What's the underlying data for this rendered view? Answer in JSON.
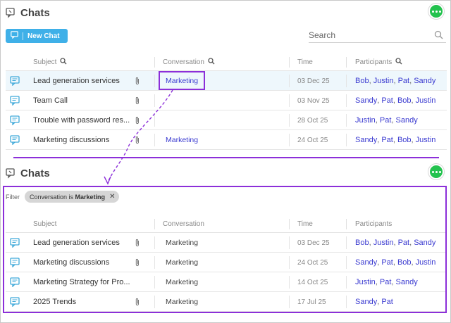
{
  "top": {
    "title": "Chats",
    "new_chat_label": "New Chat",
    "search_placeholder": "Search",
    "columns": {
      "subject": "Subject",
      "conversation": "Conversation",
      "time": "Time",
      "participants": "Participants"
    },
    "rows": [
      {
        "subject": "Lead generation services",
        "attachment": true,
        "conversation": "Marketing",
        "time": "03 Dec 25",
        "participants": [
          "Bob",
          "Justin",
          "Pat",
          "Sandy"
        ]
      },
      {
        "subject": "Team Call",
        "attachment": true,
        "conversation": "",
        "time": "03 Nov 25",
        "participants": [
          "Sandy",
          "Pat",
          "Bob",
          "Justin"
        ]
      },
      {
        "subject": "Trouble with password res...",
        "attachment": true,
        "conversation": "",
        "time": "28 Oct 25",
        "participants": [
          "Justin",
          "Pat",
          "Sandy"
        ]
      },
      {
        "subject": "Marketing discussions",
        "attachment": true,
        "conversation": "Marketing",
        "time": "24 Oct 25",
        "participants": [
          "Sandy",
          "Pat",
          "Bob",
          "Justin"
        ]
      }
    ]
  },
  "bottom": {
    "title": "Chats",
    "filter_label": "Filter",
    "filter_chip_prefix": "Conversation is",
    "filter_chip_value": "Marketing",
    "columns": {
      "subject": "Subject",
      "conversation": "Conversation",
      "time": "Time",
      "participants": "Participants"
    },
    "rows": [
      {
        "subject": "Lead generation services",
        "attachment": true,
        "conversation": "Marketing",
        "time": "03 Dec 25",
        "participants": [
          "Bob",
          "Justin",
          "Pat",
          "Sandy"
        ]
      },
      {
        "subject": "Marketing discussions",
        "attachment": true,
        "conversation": "Marketing",
        "time": "24 Oct 25",
        "participants": [
          "Sandy",
          "Pat",
          "Bob",
          "Justin"
        ]
      },
      {
        "subject": "Marketing Strategy for Pro...",
        "attachment": false,
        "conversation": "Marketing",
        "time": "14 Oct 25",
        "participants": [
          "Justin",
          "Pat",
          "Sandy"
        ]
      },
      {
        "subject": "2025 Trends",
        "attachment": true,
        "conversation": "Marketing",
        "time": "17 Jul 25",
        "participants": [
          "Sandy",
          "Pat"
        ]
      }
    ]
  },
  "colors": {
    "accent_blue": "#3fb0e8",
    "highlight_purple": "#8c2fd9",
    "link_blue": "#3a3ad0",
    "status_green": "#23c24e"
  },
  "icons": [
    "chats-icon",
    "chat-bubble-icon",
    "search-icon",
    "paperclip-icon",
    "new-chat-icon",
    "close-icon"
  ]
}
